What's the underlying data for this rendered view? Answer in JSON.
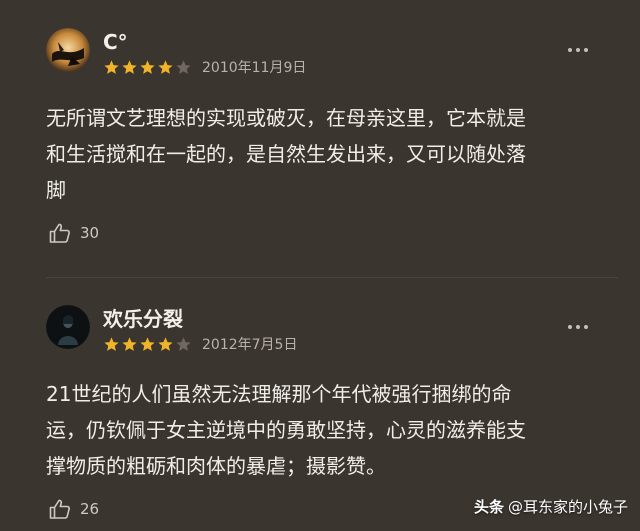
{
  "reviews": [
    {
      "username": "C°",
      "rating": 4,
      "date": "2010年11月9日",
      "content_lines": [
        "无所谓文艺理想的实现或破灭，在母亲这里，它本就是",
        "和生活搅和在一起的，是自然生发出来，又可以随处落",
        "脚"
      ],
      "likes": "30"
    },
    {
      "username": "欢乐分裂",
      "rating": 4,
      "date": "2012年7月5日",
      "content_lines": [
        "21世纪的人们虽然无法理解那个年代被强行捆绑的命",
        "运，仍钦佩于女主逆境中的勇敢坚持，心灵的滋养能支",
        "撑物质的粗砺和肉体的暴虐；摄影赞。"
      ],
      "likes": "26"
    }
  ],
  "watermark": {
    "brand": "头条",
    "handle": "@耳东家的小兔子"
  },
  "colors": {
    "background": "#3b3530",
    "star_filled": "#f0b429",
    "star_empty": "#6f6760",
    "text": "#efebe6"
  },
  "icons": {
    "more": "more-options-icon",
    "like": "thumbs-up-icon",
    "star": "star-icon"
  }
}
